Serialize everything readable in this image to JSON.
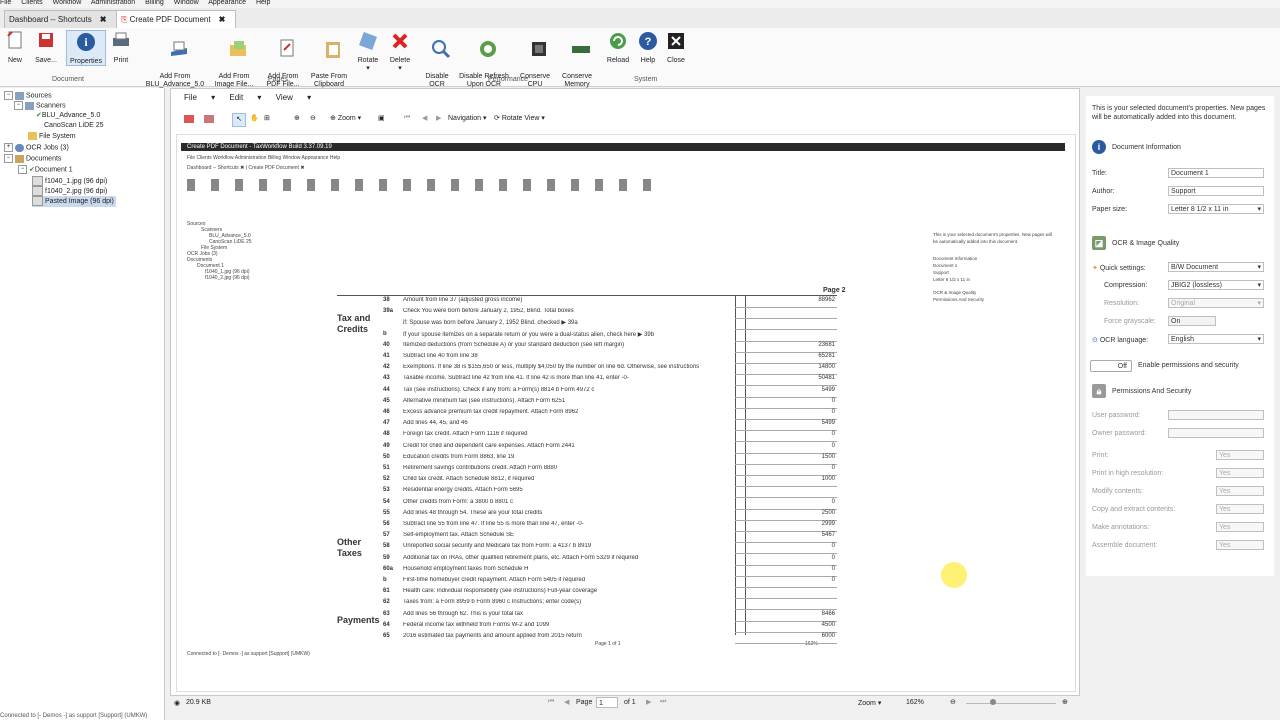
{
  "menubar": [
    "File",
    "Clients",
    "Workflow",
    "Administration",
    "Billing",
    "Window",
    "Appearance",
    "Help"
  ],
  "tabs": [
    {
      "label": "Dashboard -- Shortcuts",
      "active": false
    },
    {
      "label": "Create PDF Document",
      "active": true
    }
  ],
  "ribbon": {
    "document_buttons": [
      {
        "label": "New",
        "icon": "new-document-icon"
      },
      {
        "label": "Save...",
        "icon": "save-icon"
      },
      {
        "label": "Properties",
        "icon": "info-icon"
      },
      {
        "label": "Print",
        "icon": "printer-icon"
      }
    ],
    "document_group": "Document",
    "pages_buttons": [
      {
        "label": "Add From\nBLU_Advance_5.0",
        "icon": "scanner-icon"
      },
      {
        "label": "Add From\nImage File...",
        "icon": "folder-image-icon"
      },
      {
        "label": "Add From\nPDF File...",
        "icon": "pdf-file-icon"
      },
      {
        "label": "Paste From\nClipboard",
        "icon": "clipboard-icon"
      },
      {
        "label": "Rotate",
        "icon": "rotate-icon"
      },
      {
        "label": "Delete",
        "icon": "delete-icon"
      }
    ],
    "pages_group": "Pages",
    "performance_buttons": [
      {
        "label": "Disable\nOCR",
        "icon": "ocr-icon"
      },
      {
        "label": "Disable Refresh\nUpon OCR",
        "icon": "refresh-icon"
      },
      {
        "label": "Conserve\nCPU",
        "icon": "cpu-icon"
      },
      {
        "label": "Conserve\nMemory",
        "icon": "memory-icon"
      }
    ],
    "performance_group": "Performance",
    "system_buttons": [
      {
        "label": "Reload",
        "icon": "reload-icon"
      },
      {
        "label": "Help",
        "icon": "help-icon"
      },
      {
        "label": "Close",
        "icon": "close-icon"
      }
    ],
    "system_group": "System"
  },
  "tree": {
    "sources": "Sources",
    "scanners": "Scanners",
    "scanner1": "BLU_Advance_5.0",
    "scanner2": "CanoScan LiDE 25",
    "filesystem": "File System",
    "ocrjobs": "OCR Jobs (3)",
    "documents": "Documents",
    "document1": "Document 1",
    "page1": "f1040_1.jpg (96 dpi)",
    "page2": "f1040_2.jpg (96 dpi)",
    "page3": "Pasted Image (96 dpi)"
  },
  "docmenu": [
    "File",
    "Edit",
    "View"
  ],
  "doctool": {
    "zoom": "Zoom",
    "navigation": "Navigation",
    "rotate_view": "Rotate View"
  },
  "form": {
    "page_label": "Page 2",
    "heading_tax": "Tax and Credits",
    "heading_other": "Other Taxes",
    "heading_payments": "Payments",
    "lines": [
      {
        "no": "38",
        "text": "Amount from line 37 (adjusted gross income)",
        "amount": "88962"
      },
      {
        "no": "39a",
        "text": "Check  You were born before January 2, 1952,   Blind.   Total boxes",
        "amount": ""
      },
      {
        "no": "",
        "text": "if:  Spouse was born before January 2, 1952   Blind.  checked ▶ 39a",
        "amount": ""
      },
      {
        "no": "b",
        "text": "If your spouse itemizes on a separate return or you were a dual-status alien, check here ▶ 39b",
        "amount": ""
      },
      {
        "no": "40",
        "text": "Itemized deductions (from Schedule A) or your standard deduction (see left margin)",
        "amount": "23681"
      },
      {
        "no": "41",
        "text": "Subtract line 40 from line 38",
        "amount": "65281"
      },
      {
        "no": "42",
        "text": "Exemptions. If line 38 is $155,650 or less, multiply $4,050 by the number on line 6d. Otherwise, see instructions",
        "amount": "14800"
      },
      {
        "no": "43",
        "text": "Taxable income. Subtract line 42 from line 41. If line 42 is more than line 41, enter -0-",
        "amount": "50481"
      },
      {
        "no": "44",
        "text": "Tax (see instructions). Check if any from: a  Form(s) 8814  b  Form 4972  c",
        "amount": "5499"
      },
      {
        "no": "45",
        "text": "Alternative minimum tax (see instructions). Attach Form 6251",
        "amount": "0"
      },
      {
        "no": "46",
        "text": "Excess advance premium tax credit repayment. Attach Form 8962",
        "amount": "0"
      },
      {
        "no": "47",
        "text": "Add lines 44, 45, and 46",
        "amount": "5499"
      },
      {
        "no": "48",
        "text": "Foreign tax credit. Attach Form 1116 if required",
        "amount": "0"
      },
      {
        "no": "49",
        "text": "Credit for child and dependent care expenses. Attach Form 2441",
        "amount": "0"
      },
      {
        "no": "50",
        "text": "Education credits from Form 8863, line 19",
        "amount": "1500"
      },
      {
        "no": "51",
        "text": "Retirement savings contributions credit. Attach Form 8880",
        "amount": "0"
      },
      {
        "no": "52",
        "text": "Child tax credit. Attach Schedule 8812, if required",
        "amount": "1000"
      },
      {
        "no": "53",
        "text": "Residential energy credits. Attach Form 5695",
        "amount": ""
      },
      {
        "no": "54",
        "text": "Other credits from Form: a  3800  b  8801  c",
        "amount": "0"
      },
      {
        "no": "55",
        "text": "Add lines 48 through 54. These are your total credits",
        "amount": "2500"
      },
      {
        "no": "56",
        "text": "Subtract line 55 from line 47. If line 55 is more than line 47, enter -0-",
        "amount": "2999"
      },
      {
        "no": "57",
        "text": "Self-employment tax. Attach Schedule SE",
        "amount": "5467"
      },
      {
        "no": "58",
        "text": "Unreported social security and Medicare tax from Form: a  4137  b  8919",
        "amount": "0"
      },
      {
        "no": "59",
        "text": "Additional tax on IRAs, other qualified retirement plans, etc. Attach Form 5329 if required",
        "amount": "0"
      },
      {
        "no": "60a",
        "text": "Household employment taxes from Schedule H",
        "amount": "0"
      },
      {
        "no": "b",
        "text": "First-time homebuyer credit repayment. Attach Form 5405 if required",
        "amount": "0"
      },
      {
        "no": "61",
        "text": "Health care: individual responsibility (see instructions)  Full-year coverage",
        "amount": ""
      },
      {
        "no": "62",
        "text": "Taxes from: a  Form 8959  b  Form 8960  c  Instructions; enter code(s)",
        "amount": ""
      },
      {
        "no": "63",
        "text": "Add lines 56 through 62. This is your total tax",
        "amount": "8466"
      },
      {
        "no": "64",
        "text": "Federal income tax withheld from Forms W-2 and 1099",
        "amount": "4500"
      },
      {
        "no": "65",
        "text": "2016 estimated tax payments and amount applied from 2015 return",
        "amount": "6000"
      }
    ]
  },
  "inner_screenshot": {
    "title": "Create PDF Document - TaxWorkflow Build 3.37.09.19",
    "status": "Connected to [- Demos -] as support [Support] (UMKW)",
    "page_info": "Page 1 of 1",
    "zoom": "162%"
  },
  "props": {
    "intro": "This is your selected document's properties. New pages will be automatically added into this document.",
    "doc_info": "Document Information",
    "title_label": "Title:",
    "title_value": "Document 1",
    "author_label": "Author:",
    "author_value": "Support",
    "paper_label": "Paper size:",
    "paper_value": "Letter 8 1/2 x 11 in",
    "ocr_section": "OCR & Image Quality",
    "quick_label": "Quick settings:",
    "quick_value": "B/W Document",
    "compression_label": "Compression:",
    "compression_value": "JBIG2 (lossless)",
    "resolution_label": "Resolution:",
    "resolution_value": "Original",
    "grayscale_label": "Force grayscale:",
    "grayscale_value": "On",
    "ocrlang_label": "OCR language:",
    "ocrlang_value": "English",
    "perm_toggle": "Off",
    "perm_enable": "Enable permissions and security",
    "perm_section": "Permissions And Security",
    "user_pw": "User password:",
    "owner_pw": "Owner password:",
    "print": "Print:",
    "print_hr": "Print in high resolution:",
    "modify": "Modify contents:",
    "copy": "Copy and extract contents:",
    "annot": "Make annotations:",
    "assemble": "Assemble document:",
    "yes": "Yes"
  },
  "status": {
    "filesize": "20.9 KB",
    "page_label": "Page",
    "page_value": "1",
    "of": "of 1",
    "zoom": "Zoom",
    "zoom_value": "162%"
  },
  "bottom": "Connected to [- Demos -] as support [Support] (UMKW)"
}
